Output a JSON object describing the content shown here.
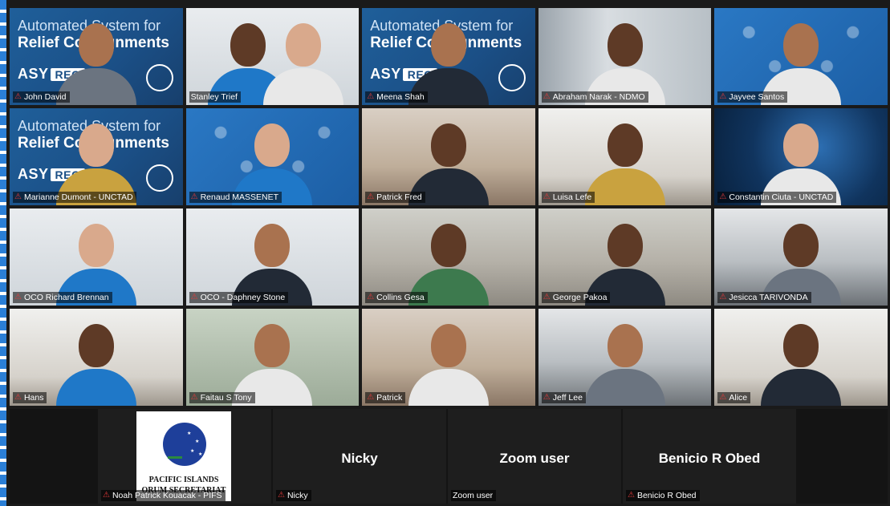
{
  "banner": {
    "line1": "Automated System for",
    "line2": "Relief Consignments",
    "logo_asy": "ASY",
    "logo_rec": "REC"
  },
  "participants": [
    {
      "name": "John David",
      "muted": true,
      "bg": "asy"
    },
    {
      "name": "Stanley Trief",
      "muted": false,
      "bg": "light",
      "active": true
    },
    {
      "name": "Meena Shah",
      "muted": true,
      "bg": "asy"
    },
    {
      "name": "Abraham Narak - NDMO",
      "muted": true,
      "bg": "curtain"
    },
    {
      "name": "Jayvee Santos",
      "muted": true,
      "bg": "asy-grid"
    },
    {
      "name": "Marianne Dumont - UNCTAD",
      "muted": true,
      "bg": "asy"
    },
    {
      "name": "Renaud MASSENET",
      "muted": true,
      "bg": "asy-grid"
    },
    {
      "name": "Patrick Fred",
      "muted": true,
      "bg": "warm"
    },
    {
      "name": "Luisa Lefe",
      "muted": true,
      "bg": "room"
    },
    {
      "name": "Constantin Ciuta - UNCTAD",
      "muted": true,
      "bg": "dark-net"
    },
    {
      "name": "OCO Richard Brennan",
      "muted": true,
      "bg": "light"
    },
    {
      "name": "OCO - Daphney Stone",
      "muted": true,
      "bg": "light"
    },
    {
      "name": "Collins Gesa",
      "muted": true,
      "bg": "office"
    },
    {
      "name": "George Pakoa",
      "muted": true,
      "bg": "office"
    },
    {
      "name": "Jesicca TARIVONDA",
      "muted": true,
      "bg": "ceiling"
    },
    {
      "name": "Hans",
      "muted": true,
      "bg": "room"
    },
    {
      "name": "Faitau S Tony",
      "muted": true,
      "bg": "green"
    },
    {
      "name": "Patrick",
      "muted": true,
      "bg": "warm"
    },
    {
      "name": "Jeff Lee",
      "muted": true,
      "bg": "ceiling"
    },
    {
      "name": "Alice",
      "muted": true,
      "bg": "room"
    }
  ],
  "bottom": [
    {
      "name": "Noah Patrick Kouacak - PIFS",
      "muted": true,
      "logo_line1": "PACIFIC ISLANDS",
      "logo_line2": "ORUM SECRETARIAT"
    },
    {
      "name": "Nicky",
      "big": "Nicky",
      "muted": true
    },
    {
      "name": "Zoom user",
      "big": "Zoom user",
      "muted": false
    },
    {
      "name": "Benicio R Obed",
      "big": "Benicio R Obed",
      "muted": true
    }
  ]
}
